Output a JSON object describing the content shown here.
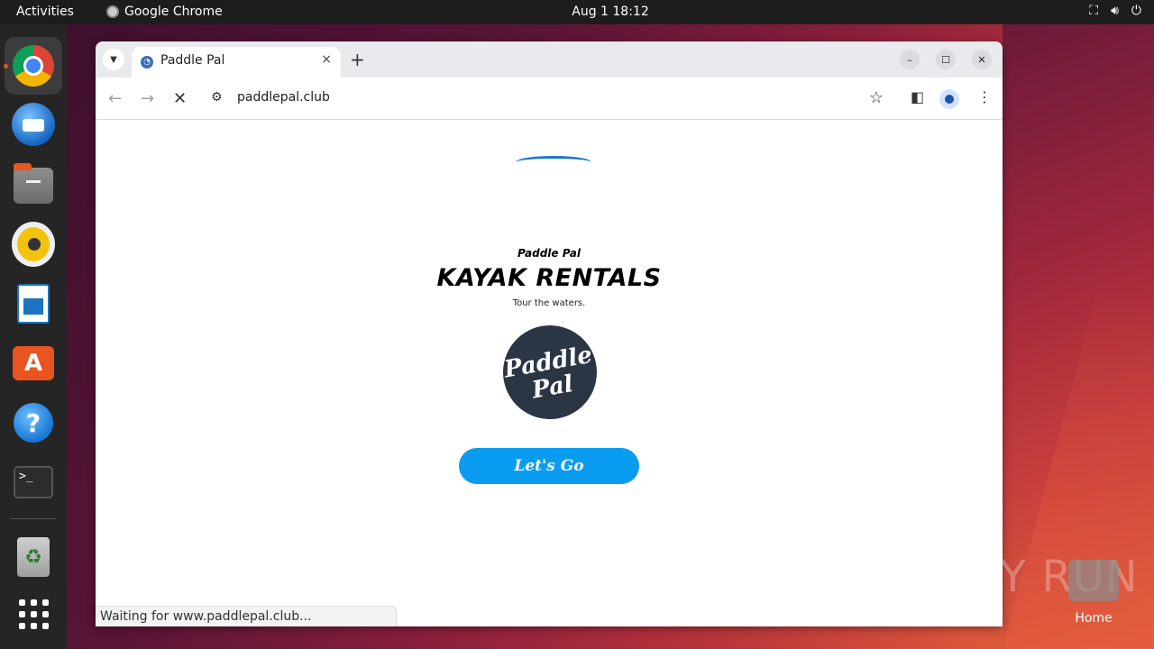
{
  "topbar": {
    "activities": "Activities",
    "app_name": "Google Chrome",
    "clock": "Aug 1  18:12",
    "tray": [
      "network-icon",
      "volume-icon",
      "power-icon"
    ]
  },
  "dock": {
    "items": [
      "chrome",
      "thunderbird",
      "files",
      "rhythmbox",
      "writer",
      "app-center",
      "help",
      "terminal",
      "trash",
      "show-apps"
    ],
    "terminal_glyph": ">_"
  },
  "browser": {
    "tab_title": "Paddle Pal",
    "tab_close": "×",
    "new_tab": "+",
    "url": "paddlepal.club",
    "status": "Waiting for www.paddlepal.club..."
  },
  "page": {
    "brand_small": "Paddle Pal",
    "headline": "KAYAK RENTALS",
    "tagline": "Tour the waters.",
    "logo_line1": "Paddle",
    "logo_line2": "Pal",
    "cta": "Let's Go"
  },
  "desktop": {
    "watermark": "ANY RUN",
    "home_label": "Home"
  },
  "colors": {
    "accent": "#0a9cf0",
    "ubuntu_orange": "#e95420",
    "logo_bg": "#2b3645"
  }
}
